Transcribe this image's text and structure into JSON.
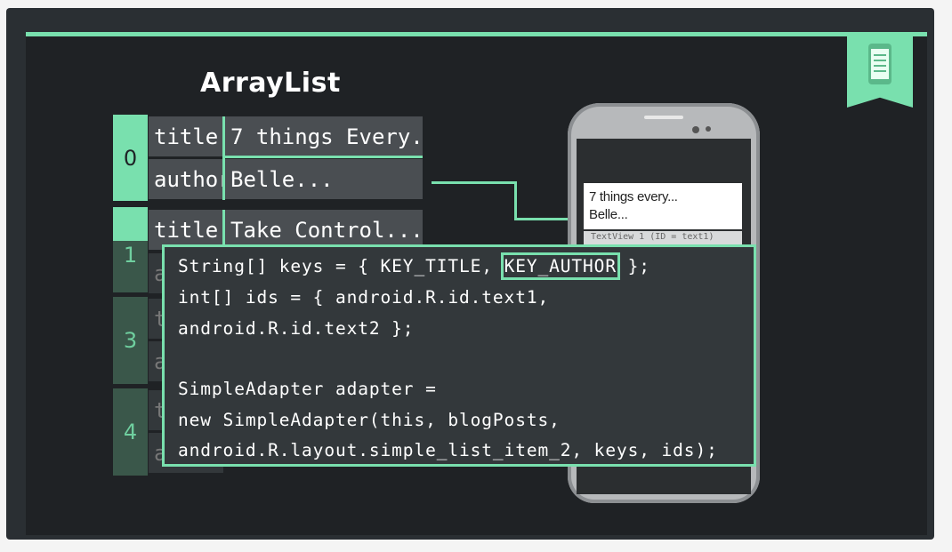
{
  "slide": {
    "title": "ArrayList",
    "bookmark_icon": "phone-list-icon",
    "accent_color": "#79e0ae",
    "rows": [
      {
        "index": "0",
        "title_key": "title",
        "title_value": "7 things Every...",
        "author_key": "author",
        "author_value": "Belle..."
      },
      {
        "index": "1",
        "title_key": "title",
        "title_value": "Take Control...",
        "author_key": "a"
      },
      {
        "index": "3",
        "title_key": "t",
        "author_key": "a"
      },
      {
        "index": "4",
        "title_key": "t",
        "author_key": "a"
      }
    ],
    "phone_list_item": {
      "text1": "7 things every...",
      "text2": "Belle...",
      "label_below": "TextView 1 (ID = text1)"
    },
    "code": {
      "line1_a": "String[] keys = { KEY_TITLE, ",
      "line1_highlight": "KEY_AUTHOR",
      "line1_b": " };",
      "line2": "int[] ids = { android.R.id.text1,",
      "line3": "android.R.id.text2 };",
      "line4": "SimpleAdapter adapter =",
      "line5": "new SimpleAdapter(this, blogPosts,",
      "line6": "android.R.layout.simple_list_item_2, keys, ids);"
    }
  }
}
